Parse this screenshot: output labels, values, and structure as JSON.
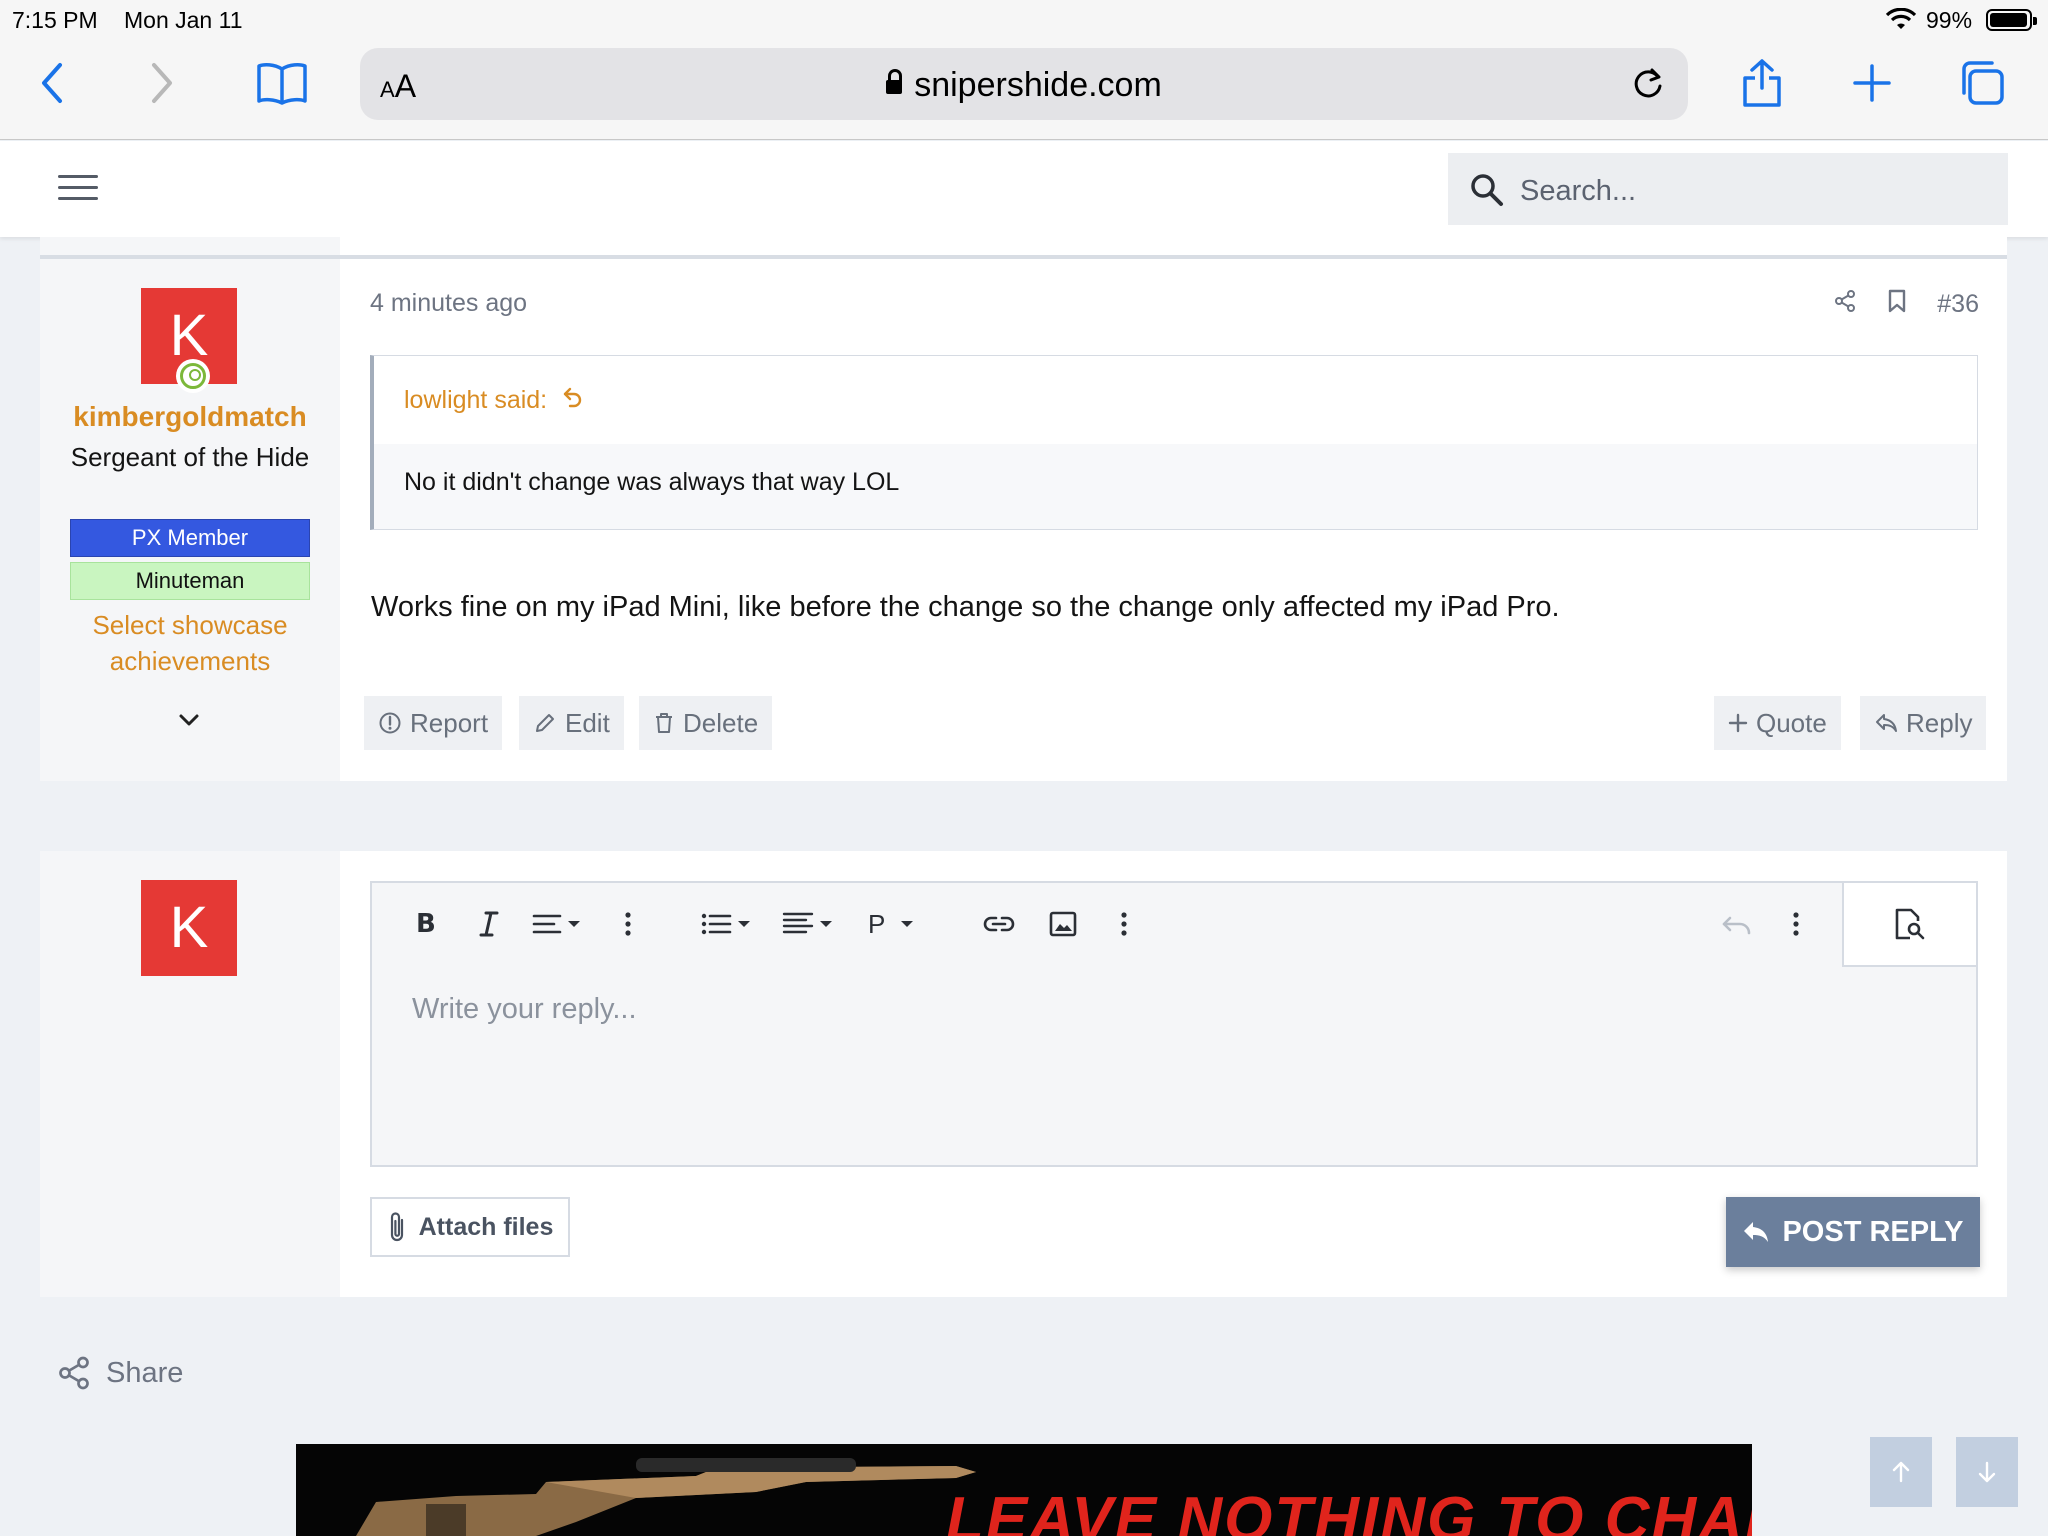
{
  "status_bar": {
    "time": "7:15 PM",
    "date": "Mon Jan 11",
    "battery": "99%"
  },
  "browser": {
    "text_size_label": "AA",
    "url": "snipershide.com"
  },
  "header": {
    "search_placeholder": "Search..."
  },
  "post": {
    "time": "4 minutes ago",
    "number": "#36",
    "user": {
      "initial": "K",
      "name": "kimbergoldmatch",
      "title": "Sergeant of the Hide",
      "banner_px": "PX Member",
      "banner_minuteman": "Minuteman",
      "showcase": "Select showcase achievements"
    },
    "quote": {
      "author": "lowlight said:",
      "text": "No it didn't change was always that way LOL"
    },
    "body": "Works fine on my iPad Mini, like before the change so the change only affected my iPad Pro.",
    "actions": {
      "report": "Report",
      "edit": "Edit",
      "delete": "Delete",
      "quote": "Quote",
      "reply": "Reply"
    }
  },
  "quick_reply": {
    "avatar_initial": "K",
    "placeholder": "Write your reply...",
    "toolbar": {
      "bold": "B",
      "paragraph": "P"
    },
    "attach_label": "Attach files",
    "submit_label": "POST REPLY"
  },
  "share_label": "Share",
  "ad": {
    "text": "LEAVE NOTHING TO CHANCE"
  },
  "colors": {
    "accent_orange": "#d98c23",
    "px_banner": "#3458e0",
    "minuteman_banner": "#c9f5c0",
    "avatar_red": "#e53935",
    "button_slate": "#6b7f9c",
    "ios_blue": "#1a73e8"
  }
}
